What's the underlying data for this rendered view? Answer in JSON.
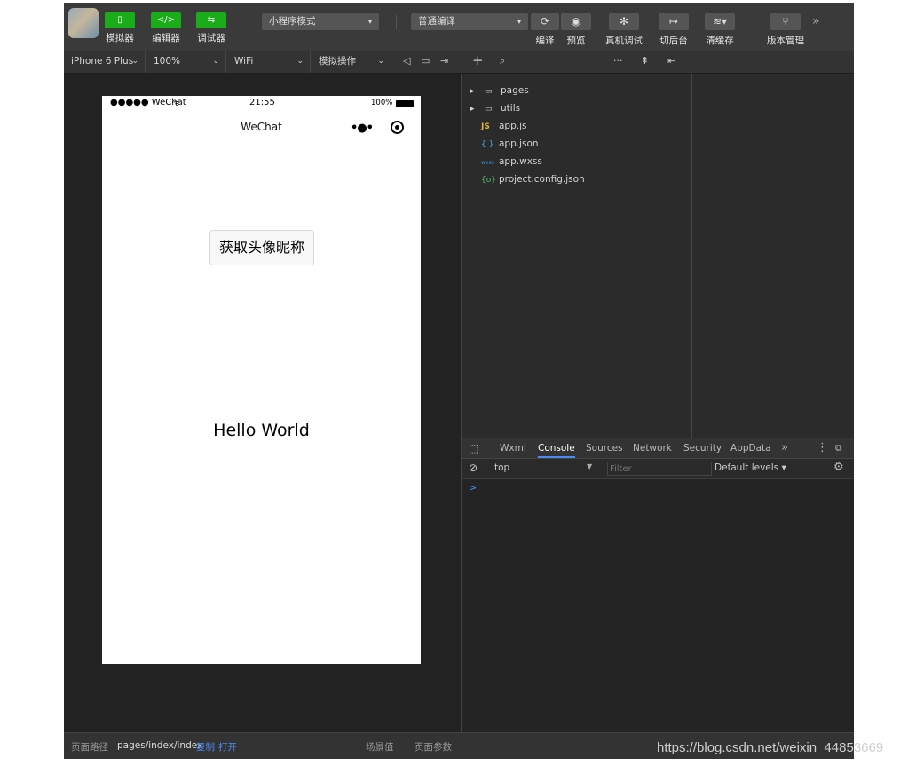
{
  "toolbar": {
    "simulator_label": "模拟器",
    "editor_label": "编辑器",
    "debugger_label": "调试器",
    "mode_select": "小程序模式",
    "compile_select": "普通编译",
    "compile_label": "编译",
    "preview_label": "预览",
    "remote_debug_label": "真机调试",
    "background_label": "切后台",
    "clear_cache_label": "清缓存",
    "version_label": "版本管理",
    "more": "»"
  },
  "bar2": {
    "device": "iPhone 6 Plus",
    "zoom": "100%",
    "network": "WiFi",
    "simulate_op": "模拟操作"
  },
  "phone": {
    "signal": "●●●●● WeChat",
    "time": "21:55",
    "battery": "100%",
    "nav_title": "WeChat",
    "button_label": "获取头像昵称",
    "hello": "Hello World"
  },
  "files": [
    {
      "name": "pages",
      "icon": "folder-icon"
    },
    {
      "name": "utils",
      "icon": "folder-icon"
    },
    {
      "name": "app.js",
      "icon": "js-icon"
    },
    {
      "name": "app.json",
      "icon": "json-icon"
    },
    {
      "name": "app.wxss",
      "icon": "wxss-icon"
    },
    {
      "name": "project.config.json",
      "icon": "config-icon"
    }
  ],
  "devtools": {
    "tabs": [
      "Wxml",
      "Console",
      "Sources",
      "Network",
      "Security",
      "AppData"
    ],
    "active_tab": "Console",
    "context": "top",
    "filter_placeholder": "Filter",
    "levels": "Default levels",
    "prompt": ">"
  },
  "bottom": {
    "path_label": "页面路径",
    "path_value": "pages/index/index",
    "copy": "复制",
    "open": "打开",
    "scene": "场景值",
    "params": "页面参数"
  },
  "watermark": "https://blog.csdn.net/weixin_44853669",
  "colors": {
    "accent_green": "#1aad19",
    "link_blue": "#4c8bf5",
    "panel_dark": "#2b2b2b"
  }
}
